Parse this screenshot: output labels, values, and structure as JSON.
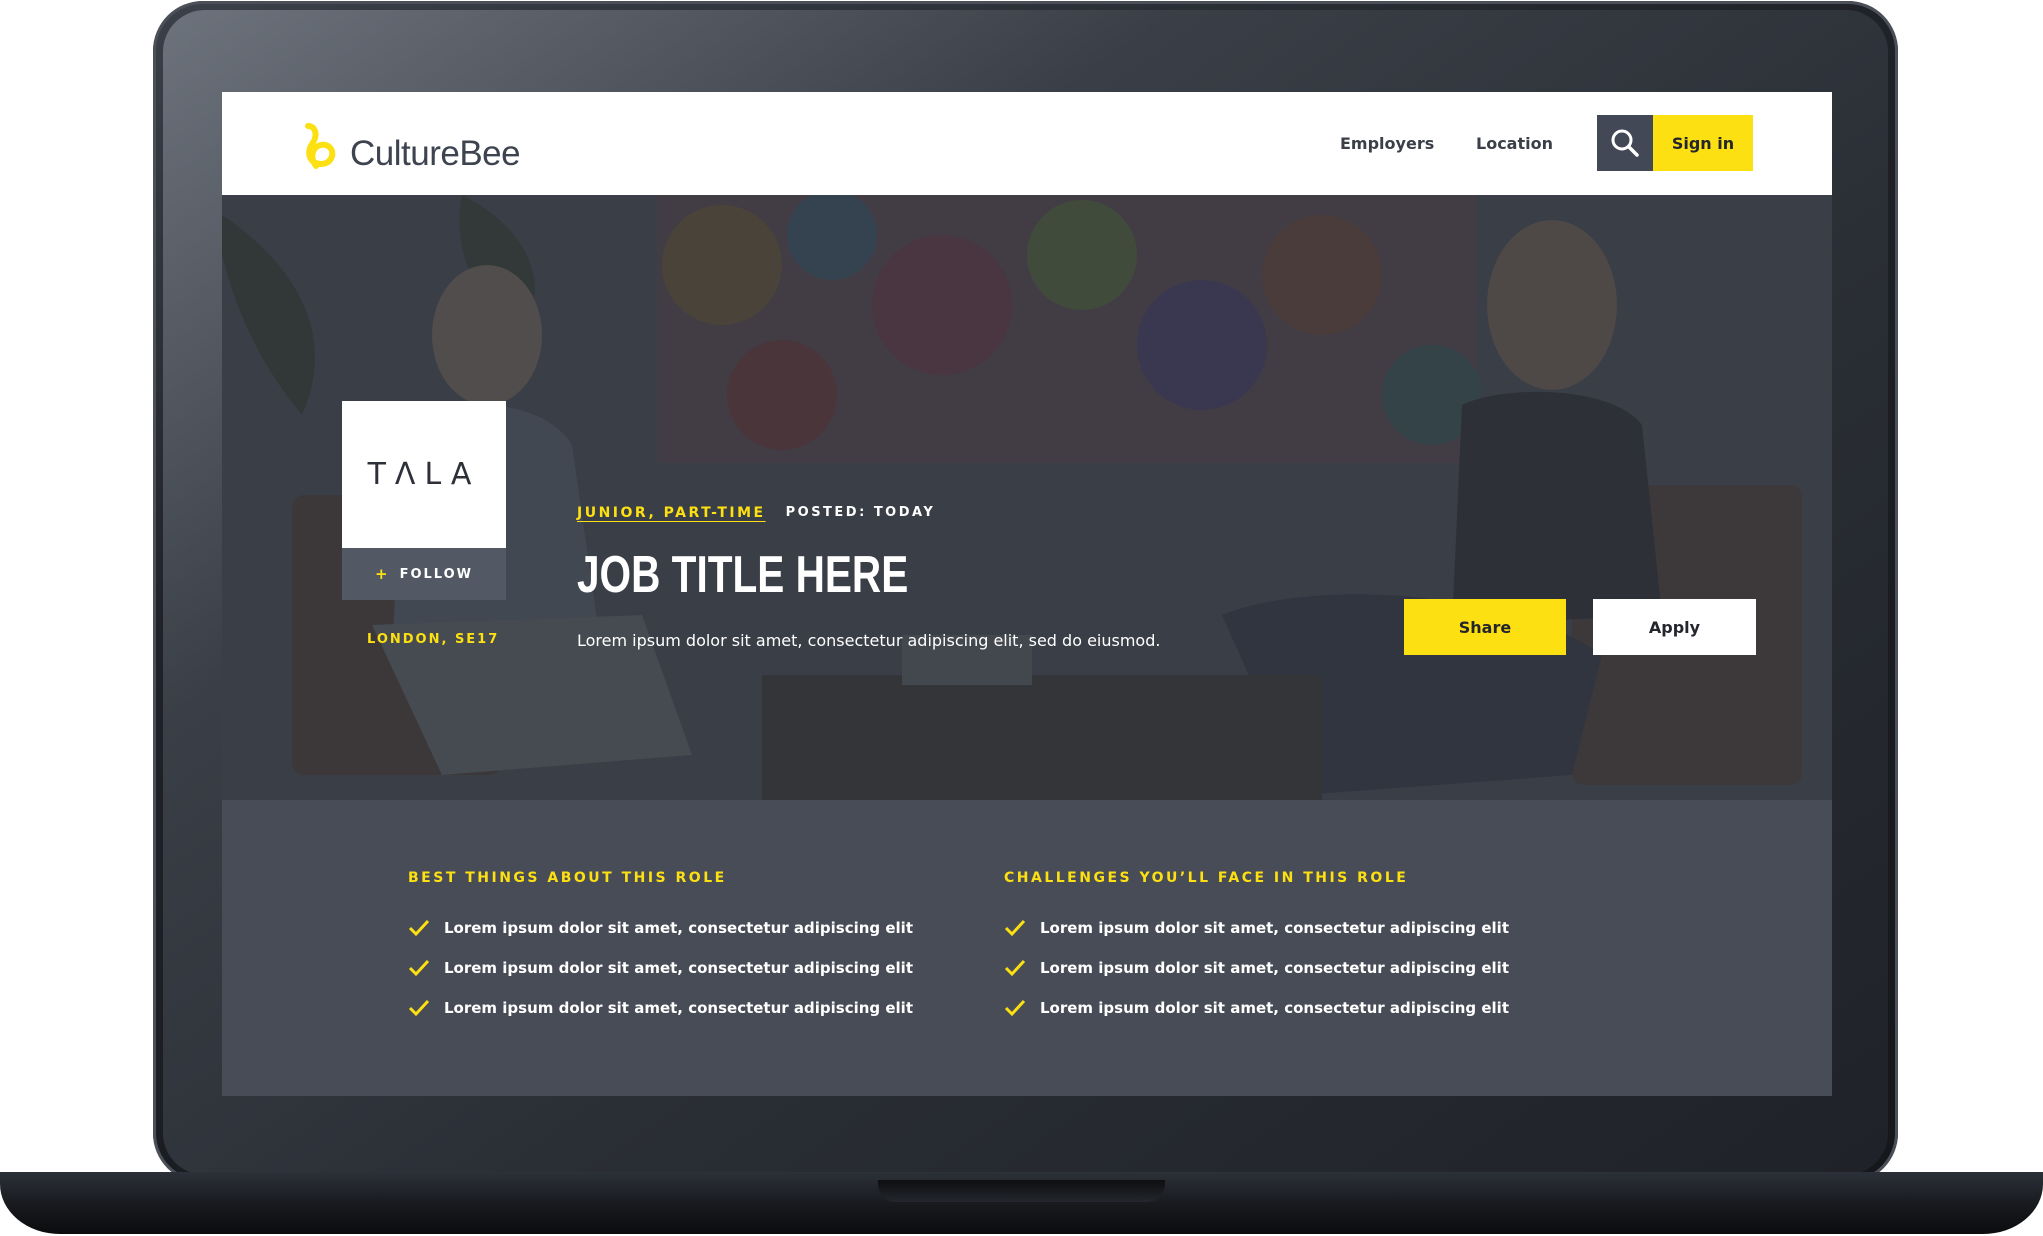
{
  "brand": {
    "name": "CultureBee",
    "accent_color": "#fde012",
    "dark_color": "#474c57"
  },
  "nav": {
    "employers": "Employers",
    "location": "Location",
    "search_icon": "search-icon",
    "signin": "Sign in"
  },
  "company": {
    "logo_text": "TΛLA",
    "follow_label": "FOLLOW",
    "location": "LONDON, SE17"
  },
  "job": {
    "type": "JUNIOR, PART-TIME",
    "posted": "POSTED: TODAY",
    "title": "JOB TITLE HERE",
    "description": "Lorem ipsum dolor sit amet, consectetur adipiscing elit, sed do eiusmod."
  },
  "actions": {
    "share": "Share",
    "apply": "Apply"
  },
  "best": {
    "heading": "BEST THINGS ABOUT THIS ROLE",
    "items": [
      "Lorem ipsum dolor sit amet, consectetur adipiscing elit",
      "Lorem ipsum dolor sit amet, consectetur adipiscing elit",
      "Lorem ipsum dolor sit amet, consectetur adipiscing elit"
    ]
  },
  "challenges": {
    "heading": "CHALLENGES YOU’LL FACE IN THIS ROLE",
    "items": [
      "Lorem ipsum dolor sit amet, consectetur adipiscing elit",
      "Lorem ipsum dolor sit amet, consectetur adipiscing elit",
      "Lorem ipsum dolor sit amet, consectetur adipiscing elit"
    ]
  }
}
